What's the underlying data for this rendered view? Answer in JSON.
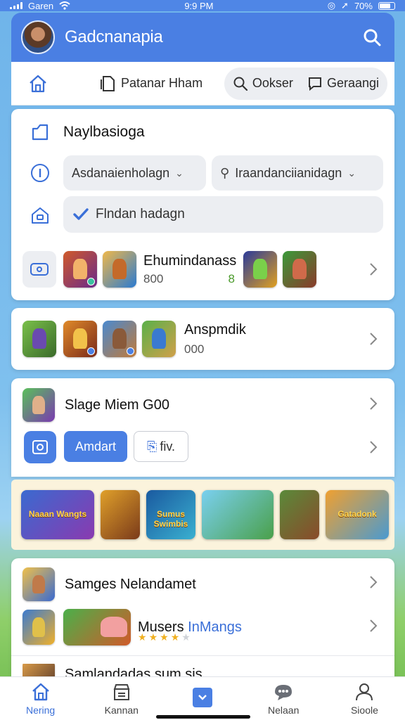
{
  "status": {
    "carrier": "Garen",
    "time": "9:9 PM",
    "battery": "70%"
  },
  "header": {
    "title": "Gadcnanapia"
  },
  "tabs": {
    "main_label": "Patanar Hham",
    "pill_left": "Ookser",
    "pill_right": "Geraangi"
  },
  "menu": {
    "heading": "Naylbasioga",
    "select_left": "Asdanaienholagn",
    "select_right": "Iraandanciianidagn",
    "checkbox_label": "Flndan hadagn",
    "checkbox_checked": true
  },
  "row_games1": {
    "title": "Ehumindanass",
    "count": "800",
    "extra": "8"
  },
  "row_games2": {
    "title": "Anspmdik",
    "count": "000"
  },
  "section3": {
    "title": "Slage Miem G00",
    "apply_label": "Amdart",
    "tv_label": "fiv."
  },
  "banner_tiles": [
    "Naaan Wangts",
    "",
    "Sumus Swimbis",
    "",
    "",
    "Gatadonk"
  ],
  "list_items": [
    {
      "title": "Samges Nelandamet"
    },
    {
      "title_prefix": "Musers",
      "title_accent": "InMangs",
      "rating": 4
    }
  ],
  "partial_item": "Samlandadas sum sis",
  "bottom_nav": [
    {
      "label": "Nering",
      "icon": "home-icon",
      "active": true
    },
    {
      "label": "Kannan",
      "icon": "store-icon",
      "active": false
    },
    {
      "label": "",
      "icon": "center-tab-icon",
      "active": false
    },
    {
      "label": "Nelaan",
      "icon": "chat-icon",
      "active": false
    },
    {
      "label": "Sioole",
      "icon": "profile-icon",
      "active": false
    }
  ],
  "colors": {
    "primary": "#4a7fe3",
    "background": "#7fc0ee",
    "card": "#ffffff",
    "banner": "#fbf3dc"
  }
}
